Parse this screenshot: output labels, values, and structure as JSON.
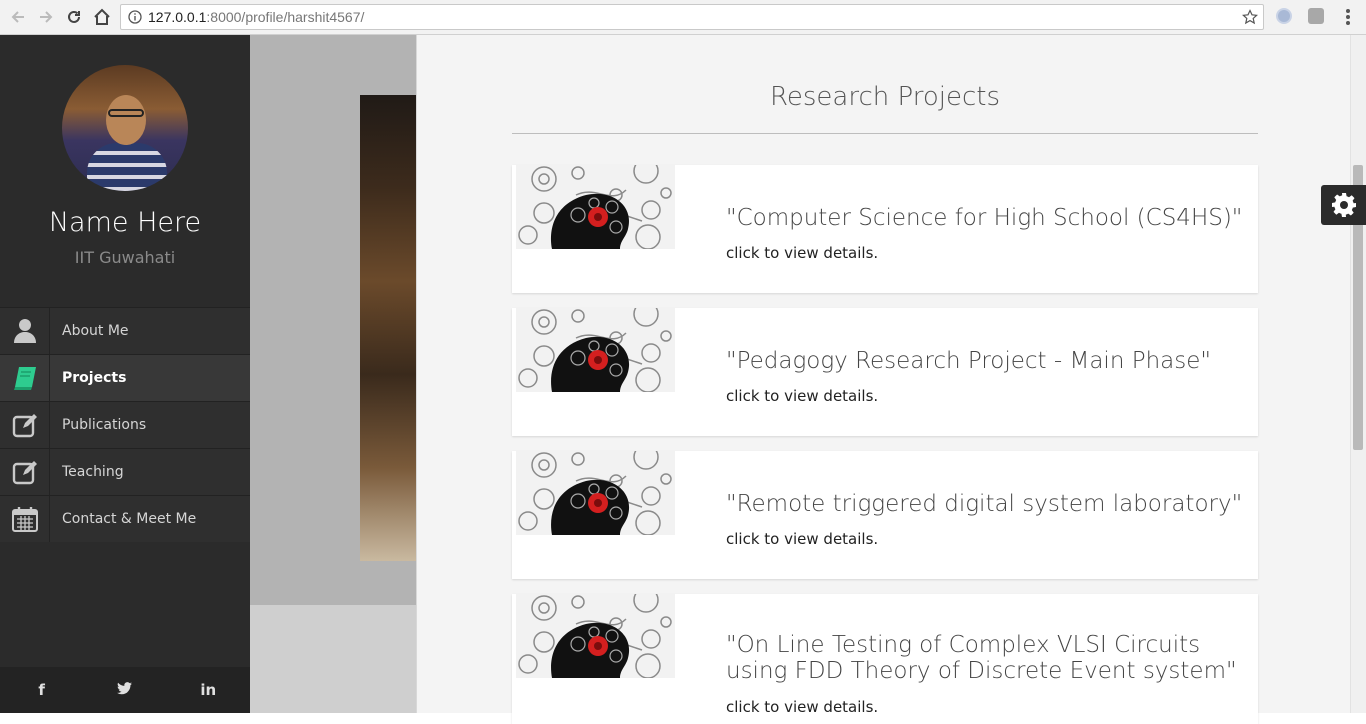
{
  "browser": {
    "url_host": "127.0.0.1",
    "url_rest": ":8000/profile/harshit4567/"
  },
  "profile": {
    "name": "Name Here",
    "institution": "IIT Guwahati"
  },
  "menu": {
    "items": [
      {
        "label": "About Me",
        "icon": "user-icon"
      },
      {
        "label": "Projects",
        "icon": "book-icon",
        "active": true
      },
      {
        "label": "Publications",
        "icon": "edit-icon"
      },
      {
        "label": "Teaching",
        "icon": "edit-icon"
      },
      {
        "label": "Contact & Meet Me",
        "icon": "calendar-icon"
      }
    ]
  },
  "social": {
    "facebook": "f",
    "twitter": "t",
    "linkedin": "in"
  },
  "panel": {
    "title": "Research Projects",
    "projects": [
      {
        "title": "\"Computer Science for High School (CS4HS)\"",
        "subtitle": "click to view details."
      },
      {
        "title": "\"Pedagogy Research Project - Main Phase\"",
        "subtitle": "click to view details."
      },
      {
        "title": "\"Remote triggered digital system laboratory\"",
        "subtitle": "click to view details."
      },
      {
        "title": "\"On Line Testing of Complex VLSI Circuits using FDD Theory of Discrete Event system\"",
        "subtitle": "click to view details."
      }
    ]
  },
  "colors": {
    "accent": "#2ecc8f",
    "sidebar": "#2b2b2b"
  }
}
